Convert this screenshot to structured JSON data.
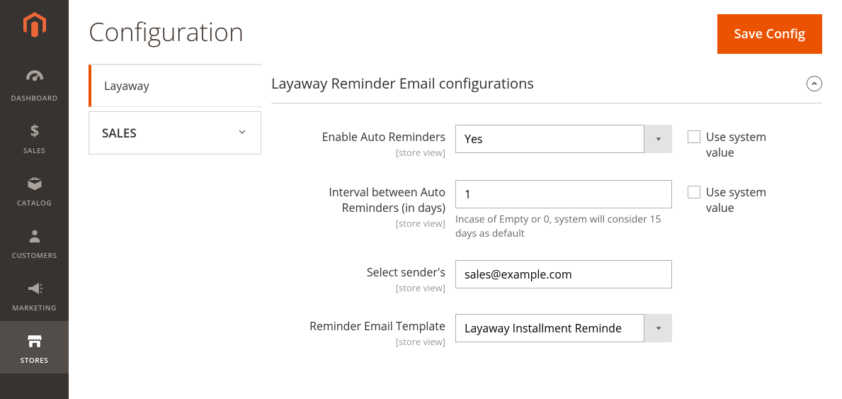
{
  "sidebar": {
    "items": [
      {
        "label": "DASHBOARD"
      },
      {
        "label": "SALES"
      },
      {
        "label": "CATALOG"
      },
      {
        "label": "CUSTOMERS"
      },
      {
        "label": "MARKETING"
      },
      {
        "label": "STORES"
      }
    ]
  },
  "header": {
    "title": "Configuration",
    "save_label": "Save Config"
  },
  "config_nav": {
    "sub_item": "Layaway",
    "section_header": "SALES"
  },
  "section": {
    "title": "Layaway Reminder Email configurations"
  },
  "form": {
    "scope_label": "[store view]",
    "system_value_label": "Use system value",
    "fields": {
      "enable": {
        "label": "Enable Auto Reminders",
        "value": "Yes"
      },
      "interval": {
        "label": "Interval between Auto Reminders (in days)",
        "value": "1",
        "note": "Incase of Empty or 0, system will consider 15 days as default"
      },
      "sender": {
        "label": "Select sender's",
        "value": "sales@example.com"
      },
      "template": {
        "label": "Reminder Email Template",
        "value": "Layaway Installment Reminde"
      }
    }
  }
}
